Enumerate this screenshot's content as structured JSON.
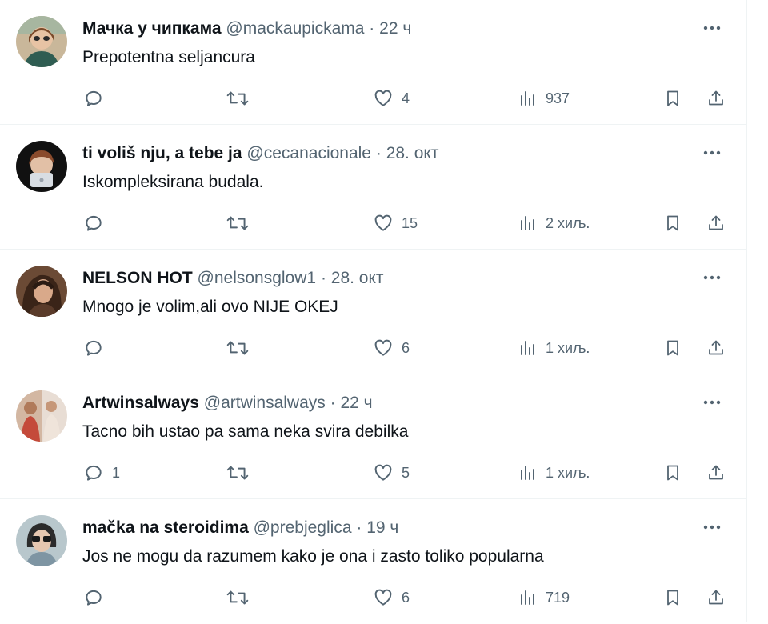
{
  "tweets": [
    {
      "name": "Мачка у чипкама",
      "handle": "@mackaupickama",
      "time": "22 ч",
      "text": "Prepotentna seljancura",
      "replies": "",
      "likes": "4",
      "views": "937"
    },
    {
      "name": "ti voliš nju, a tebe ja",
      "handle": "@cecanacionale",
      "time": "28. окт",
      "text": "Iskompleksirana budala.",
      "replies": "",
      "likes": "15",
      "views": "2 хиљ."
    },
    {
      "name": "NELSON HOT",
      "handle": "@nelsonsglow1",
      "time": "28. окт",
      "text": "Mnogo je volim,ali ovo NIJE OKEJ",
      "replies": "",
      "likes": "6",
      "views": "1 хиљ."
    },
    {
      "name": "Artwinsalways",
      "handle": "@artwinsalways",
      "time": "22 ч",
      "text": "Tacno bih ustao pa sama neka svira debilka",
      "replies": "1",
      "likes": "5",
      "views": "1 хиљ."
    },
    {
      "name": "mačka na steroidima",
      "handle": "@prebjeglica",
      "time": "19 ч",
      "text": "Jos ne mogu da razumem kako je ona i zasto toliko popularna",
      "replies": "",
      "likes": "6",
      "views": "719"
    }
  ],
  "separator": "·",
  "icons": {
    "more": "more-icon",
    "reply": "reply-icon",
    "retweet": "retweet-icon",
    "like": "like-icon",
    "views": "views-icon",
    "bookmark": "bookmark-icon",
    "share": "share-icon"
  },
  "colors": {
    "text": "#0f1419",
    "secondary": "#536471",
    "divider": "#eff3f4"
  }
}
